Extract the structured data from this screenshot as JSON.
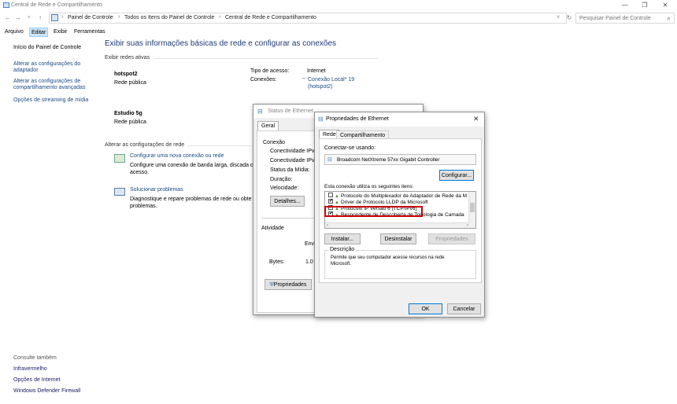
{
  "window": {
    "title": "Central de Rede e Compartilhamento",
    "controls": [
      "—",
      "❐",
      "✕"
    ]
  },
  "address": {
    "crumbs": [
      "Painel de Controle",
      "Todos os Itens do Painel de Controle",
      "Central de Rede e Compartilhamento"
    ],
    "search_placeholder": "Pesquisar Painel de Controle"
  },
  "menu": [
    "Arquivo",
    "Editar",
    "Exibir",
    "Ferramentas"
  ],
  "sidebar": {
    "home": "Início do Painel de Controle",
    "links": [
      [
        "Alterar as configurações do",
        "adaptador"
      ],
      [
        "Alterar as configurações de",
        "compartilhamento avançadas"
      ],
      [
        "Opções de streaming de mídia"
      ]
    ],
    "see_also_title": "Consulte também",
    "see_also": [
      "Infravermelho",
      "Opções de Internet",
      "Windows Defender Firewall"
    ]
  },
  "main": {
    "title": "Exibir suas informações básicas de rede e configurar as conexões",
    "active_header": "Exibir redes ativas",
    "networks": [
      {
        "name": "hotspot2",
        "type": "Rede pública",
        "access_label": "Tipo de acesso:",
        "access_value": "Internet",
        "conn_label": "Conexões:",
        "conn_value_1": "Conexão Local* 19",
        "conn_value_2": "(hotspot2)"
      },
      {
        "name": "Estudio 5g",
        "type": "Rede pública"
      }
    ],
    "change_header": "Alterar as configurações de rede",
    "tasks": [
      {
        "title": "Configurar uma nova conexão ou rede",
        "desc_1": "Configure uma conexão de banda larga, discada o",
        "desc_2": "acesso."
      },
      {
        "title": "Solucionar problemas",
        "desc_1": "Diagnostique e repare problemas de rede ou obte",
        "desc_2": "problemas."
      }
    ]
  },
  "status_dialog": {
    "title": "Status de Ethernet",
    "tab": "Geral",
    "conexao_label": "Conexão",
    "rows": [
      "Conectividade IPv4",
      "Conectividade IPv6",
      "Status da Mídia:",
      "Duração:",
      "Velocidade:"
    ],
    "details_btn": "Detalhes...",
    "activity_label": "Atividade",
    "sent_label": "Envi",
    "bytes_label": "Bytes:",
    "bytes_value": "1.0",
    "properties_btn": "Propriedades"
  },
  "props_dialog": {
    "title": "Propriedades de Ethernet",
    "tabs": [
      "Rede",
      "Compartilhamento"
    ],
    "connect_using_label": "Conectar-se usando:",
    "adapter": "Broadcom NetXtreme 57xx Gigabit Controller",
    "configure_btn": "Configurar...",
    "items_label": "Esta conexão utiliza os seguintes itens:",
    "items": [
      {
        "label": "Protocolo do Multiplexador de Adaptador de Rede da M",
        "checked": false
      },
      {
        "label": "Driver de Protocolo LLDP da Microsoft",
        "checked": true
      },
      {
        "label": "Protocolo IP Versão 6 (TCP/IPv6)",
        "checked": true
      },
      {
        "label": "Respondente de Descoberta de Topologia de Camada",
        "checked": true
      }
    ],
    "install_btn": "Instalar...",
    "uninstall_btn": "Desinstalar",
    "properties_btn": "Propriedades",
    "description_label": "Descrição",
    "description_text_1": "Permite que seu computador acesse recursos na rede",
    "description_text_2": "Microsoft.",
    "ok_btn": "OK",
    "cancel_btn": "Cancelar"
  },
  "colors": {
    "link": "#1c4a87",
    "title_blue": "#1e3a78",
    "highlight_red": "#cc0000",
    "default_btn": "#0078d7"
  }
}
